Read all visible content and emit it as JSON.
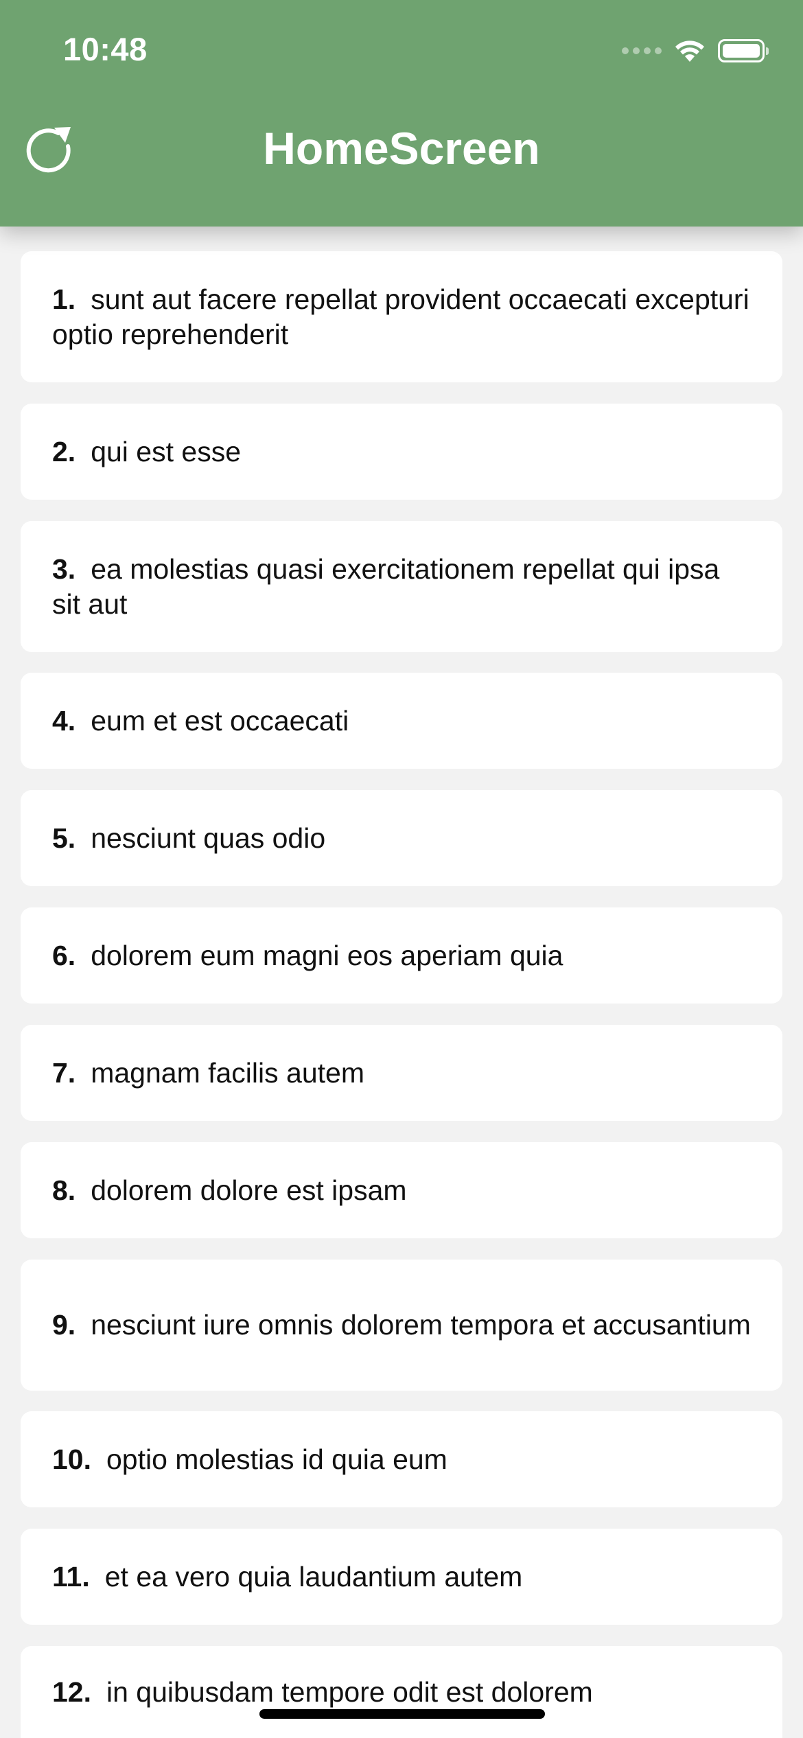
{
  "status_bar": {
    "time": "10:48"
  },
  "header": {
    "title": "HomeScreen",
    "background_color": "#6fa370",
    "refresh_icon": "refresh-icon"
  },
  "items": [
    {
      "number": "1.",
      "text": "sunt aut facere repellat provident occaecati excepturi optio reprehenderit"
    },
    {
      "number": "2.",
      "text": "qui est esse"
    },
    {
      "number": "3.",
      "text": "ea molestias quasi exercitationem repellat qui ipsa sit aut"
    },
    {
      "number": "4.",
      "text": "eum et est occaecati"
    },
    {
      "number": "5.",
      "text": "nesciunt quas odio"
    },
    {
      "number": "6.",
      "text": "dolorem eum magni eos aperiam quia"
    },
    {
      "number": "7.",
      "text": "magnam facilis autem"
    },
    {
      "number": "8.",
      "text": "dolorem dolore est ipsam"
    },
    {
      "number": "9.",
      "text": "nesciunt iure omnis dolorem tempora et accusantium"
    },
    {
      "number": "10.",
      "text": "optio molestias id quia eum"
    },
    {
      "number": "11.",
      "text": "et ea vero quia laudantium autem"
    },
    {
      "number": "12.",
      "text": "in quibusdam tempore odit est dolorem"
    }
  ]
}
